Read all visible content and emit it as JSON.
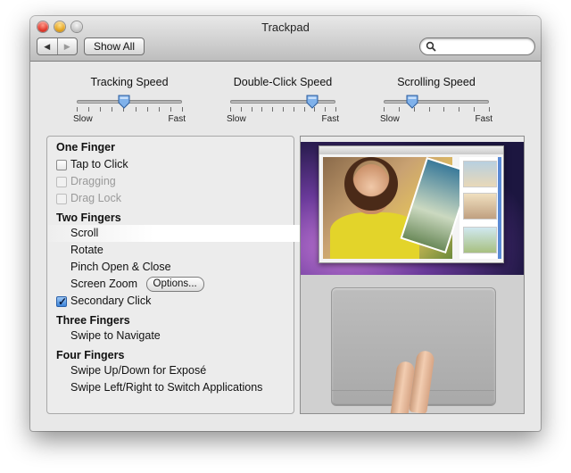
{
  "window": {
    "title": "Trackpad"
  },
  "toolbar": {
    "back_label": "◀",
    "forward_label": "▶",
    "show_all_label": "Show All",
    "search_value": "",
    "search_placeholder": ""
  },
  "sliders": [
    {
      "label": "Tracking Speed",
      "min_label": "Slow",
      "max_label": "Fast",
      "value": 0.45,
      "ticks": 10
    },
    {
      "label": "Double-Click Speed",
      "min_label": "Slow",
      "max_label": "Fast",
      "value": 0.78,
      "ticks": 11
    },
    {
      "label": "Scrolling Speed",
      "min_label": "Slow",
      "max_label": "Fast",
      "value": 0.27,
      "ticks": 8
    }
  ],
  "gestures": {
    "one_finger": {
      "header": "One Finger",
      "tap_to_click": {
        "label": "Tap to Click",
        "checked": false,
        "enabled": true
      },
      "dragging": {
        "label": "Dragging",
        "checked": false,
        "enabled": false
      },
      "drag_lock": {
        "label": "Drag Lock",
        "checked": false,
        "enabled": false
      }
    },
    "two_fingers": {
      "header": "Two Fingers",
      "scroll": "Scroll",
      "rotate": "Rotate",
      "pinch": "Pinch Open & Close",
      "screen_zoom": "Screen Zoom",
      "options_label": "Options...",
      "secondary_click": {
        "label": "Secondary Click",
        "checked": true,
        "enabled": true
      }
    },
    "three_fingers": {
      "header": "Three Fingers",
      "swipe_navigate": "Swipe to Navigate"
    },
    "four_fingers": {
      "header": "Four Fingers",
      "swipe_updown": "Swipe Up/Down for Exposé",
      "swipe_leftright": "Swipe Left/Right to Switch Applications"
    }
  },
  "selected_gesture": "Scroll"
}
